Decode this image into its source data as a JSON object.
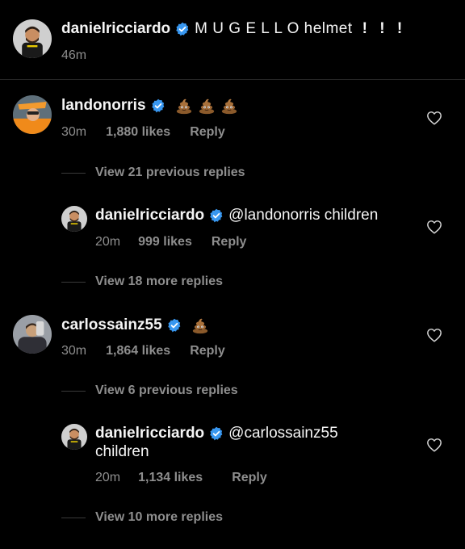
{
  "caption": {
    "username": "danielricciardo",
    "text": "M U G E L L O helmet",
    "exclaim": "! ! !",
    "time": "46m"
  },
  "comments": [
    {
      "username": "landonorris",
      "text": "",
      "emoji_count": 3,
      "time": "30m",
      "likes": "1,880 likes",
      "reply": "Reply",
      "view_link": "View 21 previous replies",
      "reply_item": {
        "username": "danielricciardo",
        "text": "@landonorris children",
        "time": "20m",
        "likes": "999 likes",
        "reply": "Reply"
      },
      "more_link": "View 18 more replies"
    },
    {
      "username": "carlossainz55",
      "text": "",
      "emoji_count": 1,
      "time": "30m",
      "likes": "1,864 likes",
      "reply": "Reply",
      "view_link": "View 6 previous replies",
      "reply_item": {
        "username": "danielricciardo",
        "text": "@carlossainz55",
        "text_line2": "children",
        "time": "20m",
        "likes": "1,134 likes",
        "reply": "Reply"
      },
      "more_link": "View 10 more replies"
    }
  ],
  "colors": {
    "background": "#000000",
    "primary_text": "#f5f5f5",
    "secondary_text": "#8e8e8e",
    "verified": "#3897f0"
  },
  "icons": [
    "verified-badge-icon",
    "poop-emoji-icon",
    "heart-icon"
  ]
}
